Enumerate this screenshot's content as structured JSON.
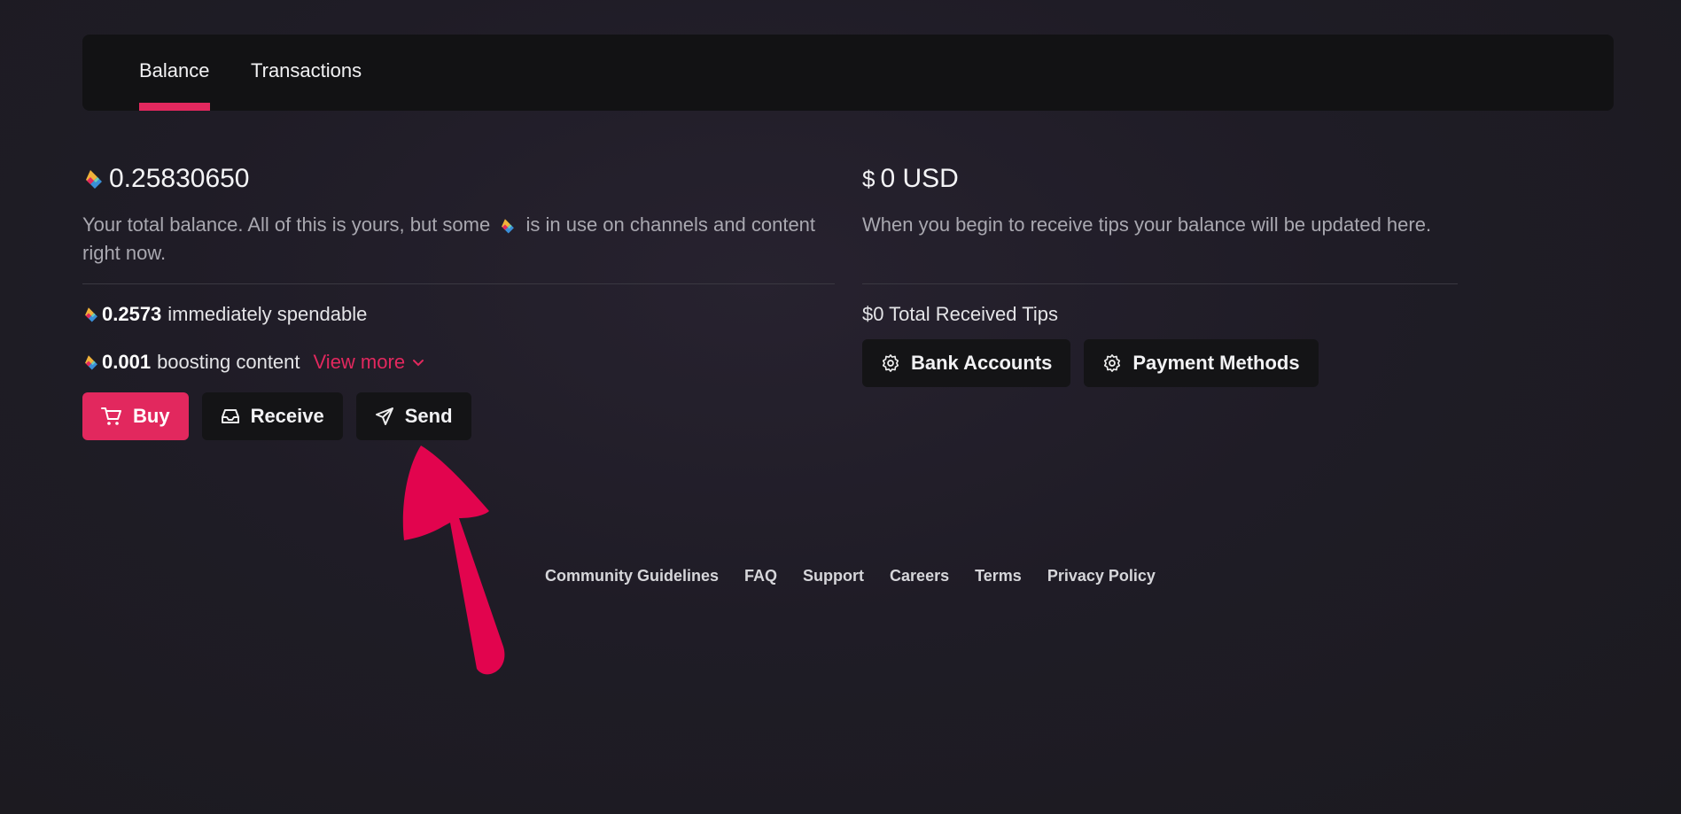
{
  "tabs": {
    "balance": "Balance",
    "transactions": "Transactions"
  },
  "wallet": {
    "total_amount": "0.25830650",
    "desc_part1": "Your total balance. All of this is yours, but some",
    "desc_part2": "is in use on channels and content right now.",
    "spendable_amount": "0.2573",
    "spendable_label": "immediately spendable",
    "boosting_amount": "0.001",
    "boosting_label": "boosting content",
    "view_more": "View more"
  },
  "actions": {
    "buy": "Buy",
    "receive": "Receive",
    "send": "Send"
  },
  "tips": {
    "currency_symbol": "$",
    "usd_amount": "0 USD",
    "desc": "When you begin to receive tips your balance will be updated here.",
    "total_received": "$0 Total Received Tips",
    "bank_accounts": "Bank Accounts",
    "payment_methods": "Payment Methods"
  },
  "footer": {
    "links": [
      "Community Guidelines",
      "FAQ",
      "Support",
      "Careers",
      "Terms",
      "Privacy Policy"
    ]
  },
  "icons": {
    "credit": "lbc-credit-icon",
    "buy": "cart-icon",
    "receive": "inbox-icon",
    "send": "send-icon",
    "settings": "gear-icon",
    "chevron": "chevron-down-icon"
  },
  "colors": {
    "accent": "#e2285e",
    "panel": "#121214",
    "button": "#141416"
  }
}
